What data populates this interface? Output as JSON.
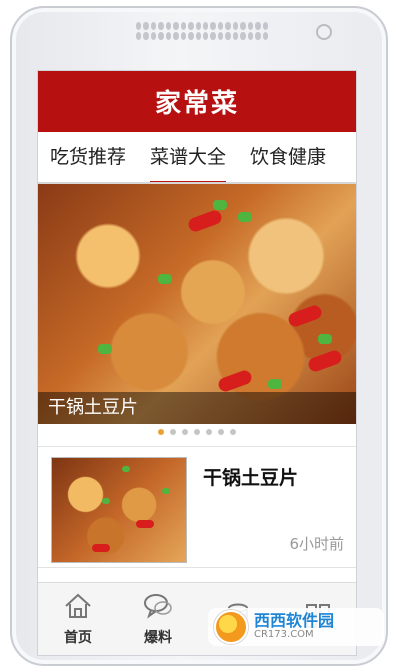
{
  "app": {
    "title": "家常菜"
  },
  "tabs": [
    {
      "label": "吃货推荐",
      "active": false
    },
    {
      "label": "菜谱大全",
      "active": true
    },
    {
      "label": "饮食健康",
      "active": false
    }
  ],
  "hero": {
    "caption": "干锅土豆片",
    "dots_total": 7,
    "dots_active_index": 0
  },
  "list": [
    {
      "title": "干锅土豆片",
      "time": "6小时前"
    }
  ],
  "bottom_nav": [
    {
      "label": "首页",
      "icon": "home-icon"
    },
    {
      "label": "爆料",
      "icon": "chat-bubble-icon"
    },
    {
      "label": "",
      "icon": "coins-stack-icon"
    },
    {
      "label": "",
      "icon": "grid-icon"
    }
  ],
  "watermark": {
    "main": "西西软件园",
    "sub": "CR173.COM"
  },
  "colors": {
    "brand_red": "#b71010",
    "active_dot": "#e8a233"
  }
}
